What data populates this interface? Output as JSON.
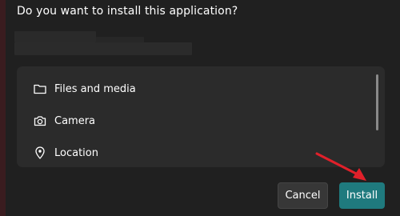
{
  "dialog": {
    "title": "Do you want to install this application?"
  },
  "permissions": {
    "items": [
      {
        "label": "Files and media",
        "icon": "folder-icon"
      },
      {
        "label": "Camera",
        "icon": "camera-icon"
      },
      {
        "label": "Location",
        "icon": "location-pin-icon"
      }
    ]
  },
  "buttons": {
    "cancel_label": "Cancel",
    "install_label": "Install"
  },
  "colors": {
    "background": "#202020",
    "panel": "#2b2b2b",
    "accent": "#1f7a7e",
    "annotation_arrow": "#e0202a"
  }
}
